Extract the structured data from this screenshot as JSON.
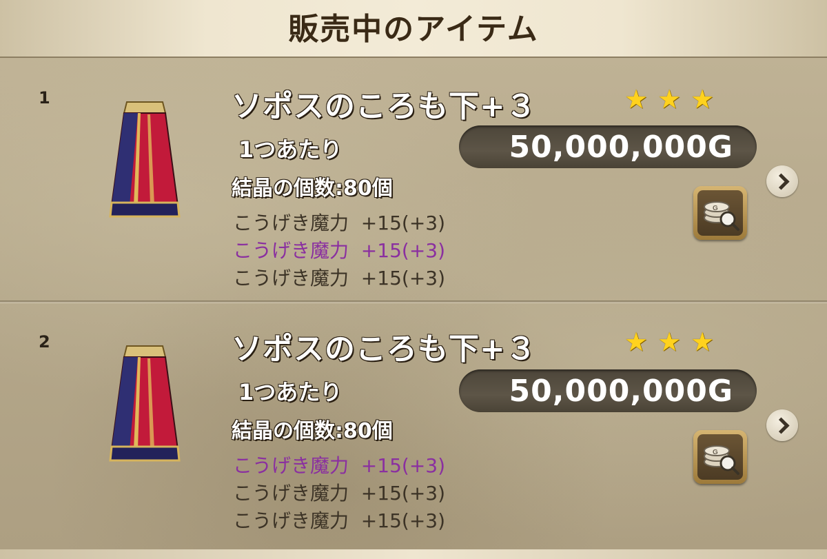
{
  "header": {
    "title": "販売中のアイテム"
  },
  "items": [
    {
      "index": "1",
      "name": "ソポスのころも下+３",
      "stars": [
        "★",
        "★",
        "★"
      ],
      "per_unit_label": "1つあたり",
      "price": "50,000,000G",
      "crystals": "結晶の個数:80個",
      "stats": [
        {
          "text": "こうげき魔力  +15(+3)",
          "color": "normal"
        },
        {
          "text": "こうげき魔力  +15(+3)",
          "color": "purple"
        },
        {
          "text": "こうげき魔力  +15(+3)",
          "color": "normal"
        }
      ]
    },
    {
      "index": "2",
      "name": "ソポスのころも下+３",
      "stars": [
        "★",
        "★",
        "★"
      ],
      "per_unit_label": "1つあたり",
      "price": "50,000,000G",
      "crystals": "結晶の個数:80個",
      "stats": [
        {
          "text": "こうげき魔力  +15(+3)",
          "color": "purple"
        },
        {
          "text": "こうげき魔力  +15(+3)",
          "color": "normal"
        },
        {
          "text": "こうげき魔力  +15(+3)",
          "color": "normal"
        }
      ]
    }
  ],
  "colors": {
    "star": "#ffd21e",
    "stat_purple": "#8a2fa0",
    "stat_normal": "#3c3326"
  }
}
